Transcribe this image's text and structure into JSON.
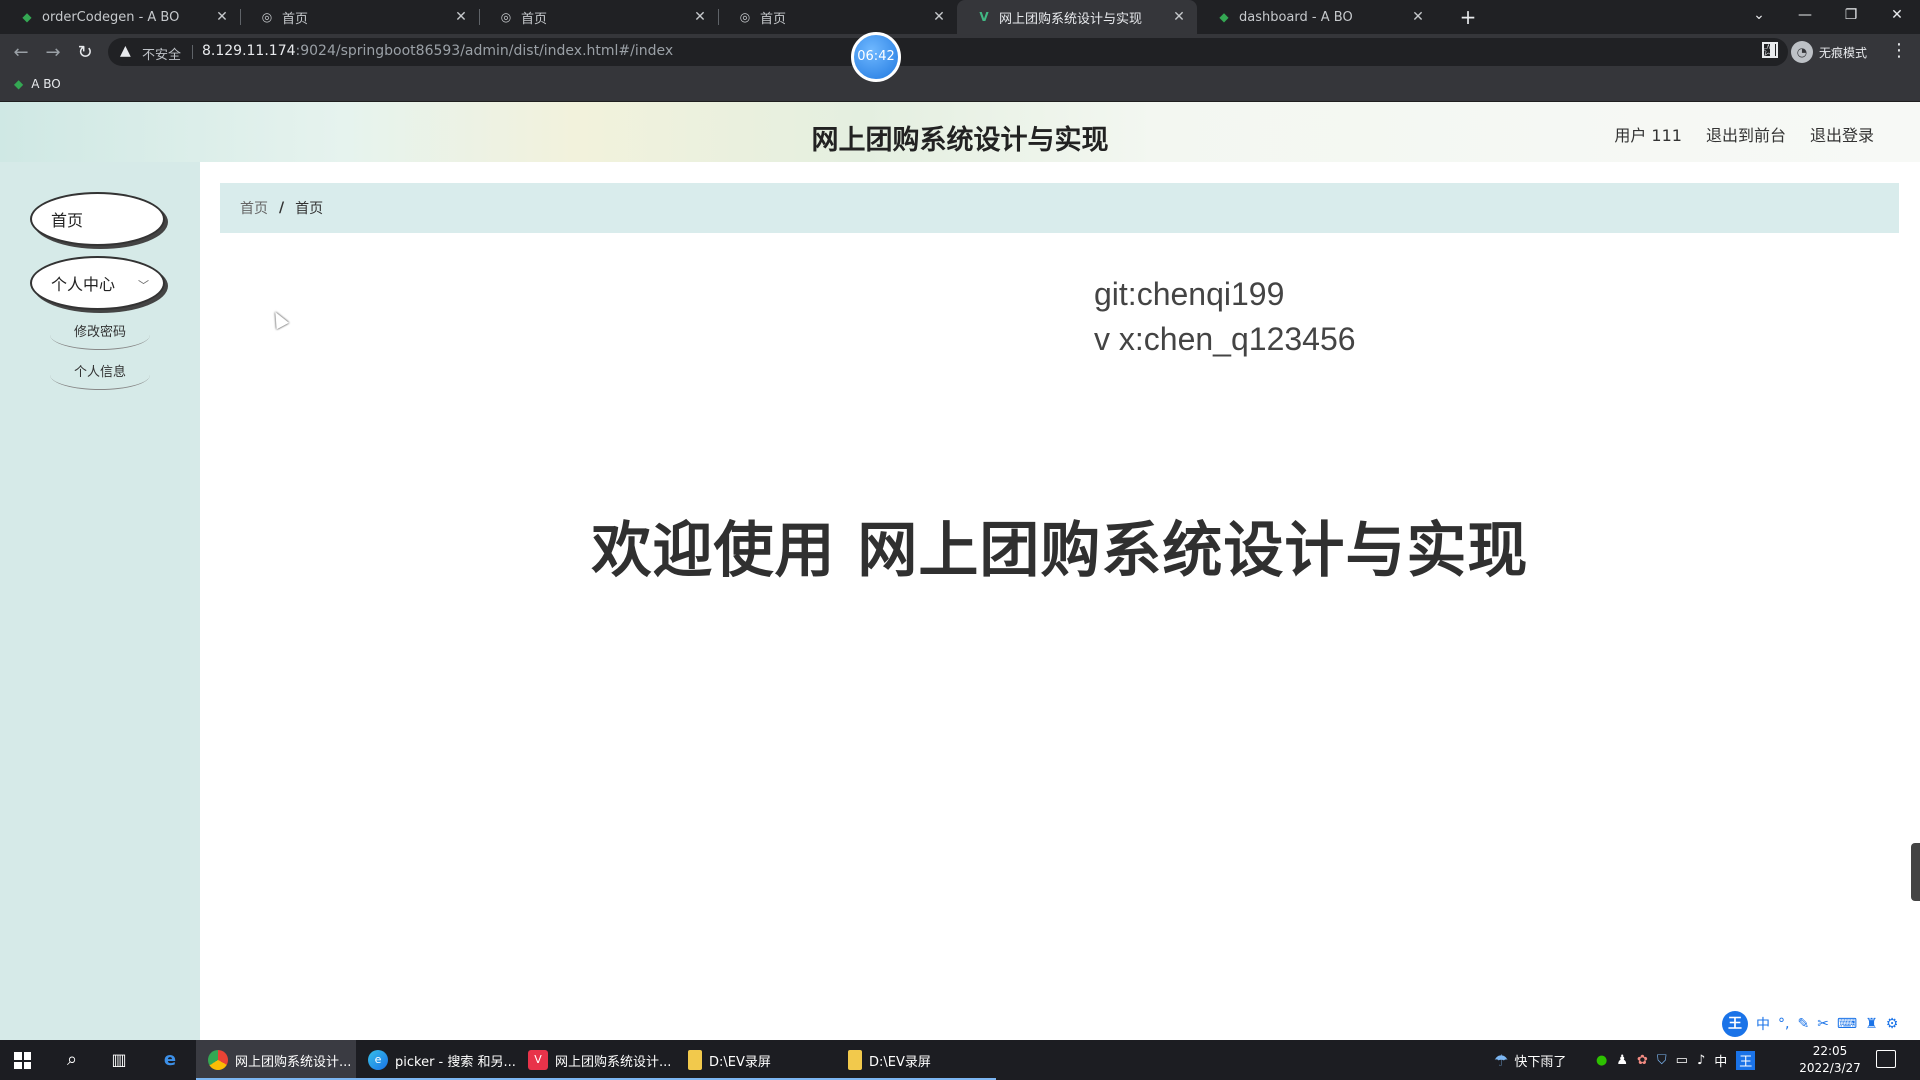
{
  "browser": {
    "tabs": [
      {
        "title": "orderCodegen - A BO",
        "favicon": "leaf-icon",
        "active": false
      },
      {
        "title": "首页",
        "favicon": "globe-icon",
        "active": false
      },
      {
        "title": "首页",
        "favicon": "globe-icon",
        "active": false
      },
      {
        "title": "首页",
        "favicon": "globe-icon",
        "active": false
      },
      {
        "title": "网上团购系统设计与实现",
        "favicon": "vue-icon",
        "active": true
      },
      {
        "title": "dashboard - A BO",
        "favicon": "leaf-icon",
        "active": false
      }
    ],
    "security_label": "不安全",
    "url_host": "8.129.11.174",
    "url_rest": ":9024/springboot86593/admin/dist/index.html#/index",
    "incognito_label": "无痕模式",
    "bookmark": "A BO",
    "recording_timer": "06:42"
  },
  "header": {
    "title": "网上团购系统设计与实现",
    "user_label": "用户 111",
    "to_front_label": "退出到前台",
    "logout_label": "退出登录"
  },
  "sidebar": {
    "home": "首页",
    "personal_center": "个人中心",
    "sub_items": [
      "修改密码",
      "个人信息"
    ]
  },
  "breadcrumb": {
    "root": "首页",
    "separator": "/",
    "current": "首页"
  },
  "main": {
    "contact_line1": "git:chenqi199",
    "contact_line2": "v x:chen_q123456",
    "welcome": "欢迎使用 网上团购系统设计与实现"
  },
  "ime": {
    "logo": "王",
    "mode": "中"
  },
  "taskbar": {
    "apps": [
      {
        "label": "网上团购系统设计...",
        "icon": "chrome-icon",
        "active": true
      },
      {
        "label": "picker - 搜索 和另...",
        "icon": "edge-icon",
        "active": false
      },
      {
        "label": "网上团购系统设计...",
        "icon": "vue-icon",
        "active": false
      },
      {
        "label": "D:\\EV录屏",
        "icon": "folder-icon",
        "active": false
      },
      {
        "label": "D:\\EV录屏",
        "icon": "folder-icon",
        "active": false
      }
    ],
    "weather": "快下雨了",
    "ime_lang": "中",
    "time": "22:05",
    "date": "2022/3/27"
  },
  "colors": {
    "sidebar_bg": "#d6eae8",
    "breadcrumb_bg": "#d9ecec",
    "accent_blue": "#1a73e8"
  }
}
